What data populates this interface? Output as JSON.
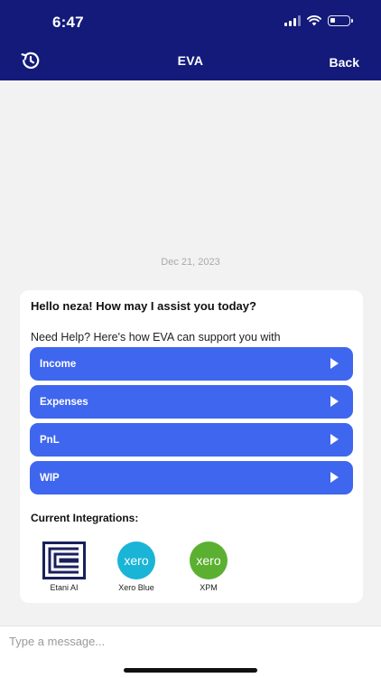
{
  "status_bar": {
    "time": "6:47",
    "battery_level": 0.25
  },
  "nav": {
    "history_icon": "history-icon",
    "title": "EVA",
    "back_label": "Back"
  },
  "chat": {
    "date": "Dec 21, 2023",
    "greeting": "Hello neza! How may I assist you today?",
    "help_text": "Need Help? Here's how EVA can support you with",
    "options": [
      {
        "label": "Income"
      },
      {
        "label": "Expenses"
      },
      {
        "label": "PnL"
      },
      {
        "label": "WIP"
      }
    ],
    "integrations_title": "Current Integrations:",
    "integrations": [
      {
        "name": "Etani AI",
        "icon": "etani-logo-icon"
      },
      {
        "name": "Xero Blue",
        "icon": "xero-blue-logo-icon",
        "logo_text": "xero",
        "color": "#1ab4d7"
      },
      {
        "name": "XPM",
        "icon": "xero-green-logo-icon",
        "logo_text": "xero",
        "color": "#5bb031"
      }
    ]
  },
  "composer": {
    "placeholder": "Type a message..."
  },
  "colors": {
    "nav_background": "#131a7a",
    "button_blue": "#3f66ee"
  }
}
